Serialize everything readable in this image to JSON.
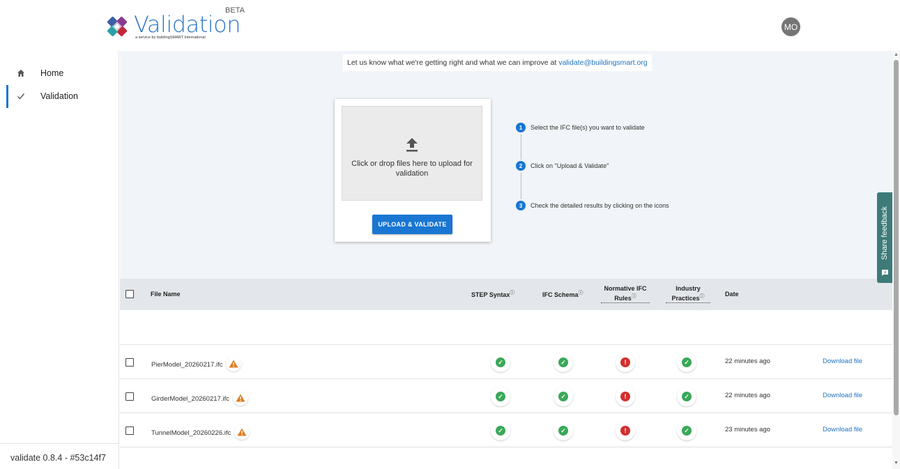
{
  "header": {
    "logo_title": "Validation",
    "logo_subtitle": "a service by buildingSMART International",
    "beta": "BETA",
    "avatar_initials": "MO"
  },
  "sidebar": {
    "items": [
      {
        "label": "Home",
        "icon": "home-icon"
      },
      {
        "label": "Validation",
        "icon": "check-icon",
        "active": true
      }
    ],
    "version": "validate 0.8.4 - #53c14f7"
  },
  "main": {
    "feedback_text": "Let us know what we're getting right and what we can improve at",
    "feedback_email": "validate@buildingsmart.org",
    "dropzone_text": "Click or drop files here to upload for validation",
    "upload_button": "UPLOAD & VALIDATE",
    "steps": [
      {
        "num": "1",
        "text": "Select the IFC file(s) you want to validate"
      },
      {
        "num": "2",
        "text": "Click on \"Upload & Validate\""
      },
      {
        "num": "3",
        "text": "Check the detailed results by clicking on the icons"
      }
    ]
  },
  "table": {
    "columns": {
      "file_name": "File Name",
      "step_syntax": "STEP Syntax",
      "ifc_schema": "IFC Schema",
      "normative_line1": "Normative IFC",
      "normative_line2": "Rules",
      "industry_line1": "Industry",
      "industry_line2": "Practices",
      "date": "Date",
      "info_mark": "ⓘ"
    },
    "rows": [
      {
        "file": "PierModel_20260217.ifc",
        "step": "ok",
        "schema": "ok",
        "normative": "error",
        "industry": "ok",
        "date": "22 minutes ago",
        "action": "Download file"
      },
      {
        "file": "GirderModel_20260217.ifc",
        "step": "ok",
        "schema": "ok",
        "normative": "error",
        "industry": "ok",
        "date": "22 minutes ago",
        "action": "Download file"
      },
      {
        "file": "TunnelModel_20260226.ifc",
        "step": "ok",
        "schema": "ok",
        "normative": "error",
        "industry": "ok",
        "date": "23 minutes ago",
        "action": "Download file"
      }
    ]
  },
  "feedback_tab": {
    "label": "Share feedback"
  },
  "colors": {
    "accent": "#1976d2",
    "ok": "#3aa859",
    "error": "#d32f2f",
    "warning": "#e07b20",
    "feedback_tab": "#3d7b78"
  }
}
